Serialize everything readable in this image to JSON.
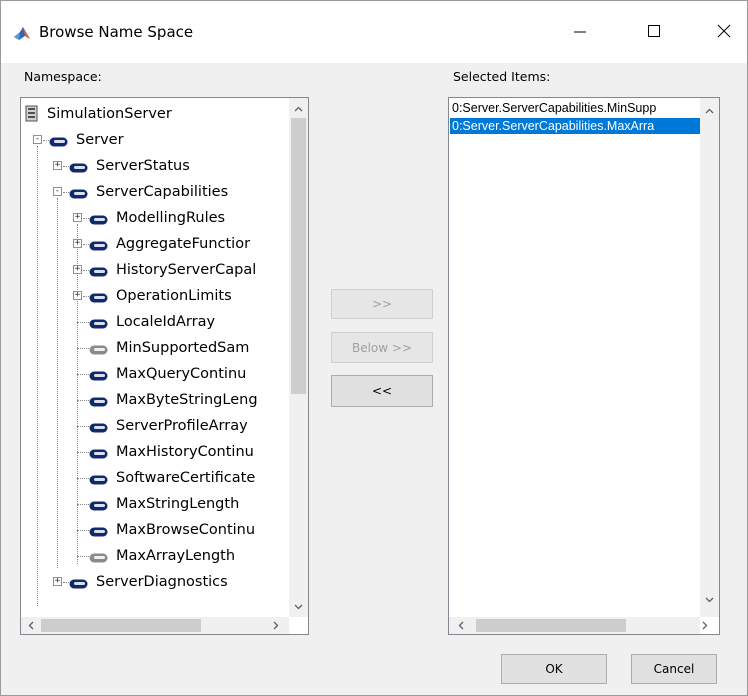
{
  "window": {
    "title": "Browse Name Space",
    "controls": {
      "minimize": "minimize",
      "maximize": "maximize",
      "close": "close"
    }
  },
  "namespace": {
    "label": "Namespace:",
    "tree": [
      {
        "label": "SimulationServer",
        "icon": "server-icon",
        "level": 0,
        "expander": ""
      },
      {
        "label": "Server",
        "icon": "object-node-icon",
        "level": 1,
        "expander": "-"
      },
      {
        "label": "ServerStatus",
        "icon": "object-node-icon",
        "level": 2,
        "expander": "+"
      },
      {
        "label": "ServerCapabilities",
        "icon": "object-node-icon",
        "level": 2,
        "expander": "-"
      },
      {
        "label": "ModellingRules",
        "icon": "object-node-icon",
        "level": 3,
        "expander": "+"
      },
      {
        "label": "AggregateFunctior",
        "icon": "object-node-icon",
        "level": 3,
        "expander": "+"
      },
      {
        "label": "HistoryServerCapal",
        "icon": "object-node-icon",
        "level": 3,
        "expander": "+"
      },
      {
        "label": "OperationLimits",
        "icon": "object-node-icon",
        "level": 3,
        "expander": "+"
      },
      {
        "label": "LocaleIdArray",
        "icon": "variable-node-icon",
        "level": 3,
        "expander": ""
      },
      {
        "label": "MinSupportedSam",
        "icon": "variable-node-gray-icon",
        "level": 3,
        "expander": ""
      },
      {
        "label": "MaxQueryContinu",
        "icon": "variable-node-icon",
        "level": 3,
        "expander": ""
      },
      {
        "label": "MaxByteStringLeng",
        "icon": "variable-node-icon",
        "level": 3,
        "expander": ""
      },
      {
        "label": "ServerProfileArray",
        "icon": "variable-node-icon",
        "level": 3,
        "expander": ""
      },
      {
        "label": "MaxHistoryContinu",
        "icon": "variable-node-icon",
        "level": 3,
        "expander": ""
      },
      {
        "label": "SoftwareCertificate",
        "icon": "variable-node-icon",
        "level": 3,
        "expander": ""
      },
      {
        "label": "MaxStringLength",
        "icon": "variable-node-icon",
        "level": 3,
        "expander": ""
      },
      {
        "label": "MaxBrowseContinu",
        "icon": "variable-node-icon",
        "level": 3,
        "expander": ""
      },
      {
        "label": "MaxArrayLength",
        "icon": "variable-node-gray-icon",
        "level": 3,
        "expander": ""
      },
      {
        "label": "ServerDiagnostics",
        "icon": "object-node-icon",
        "level": 2,
        "expander": "+"
      }
    ]
  },
  "actions": {
    "add": ">>",
    "add_below": "Below >>",
    "remove": "<<"
  },
  "selected": {
    "label": "Selected Items:",
    "items": [
      {
        "text": "0:Server.ServerCapabilities.MinSupp",
        "selected": false
      },
      {
        "text": "0:Server.ServerCapabilities.MaxArra",
        "selected": true
      }
    ]
  },
  "footer": {
    "ok": "OK",
    "cancel": "Cancel"
  },
  "colors": {
    "selection": "#0078d7",
    "node_icon": "#0f2a6b",
    "node_icon_gray": "#8a8a8a"
  }
}
